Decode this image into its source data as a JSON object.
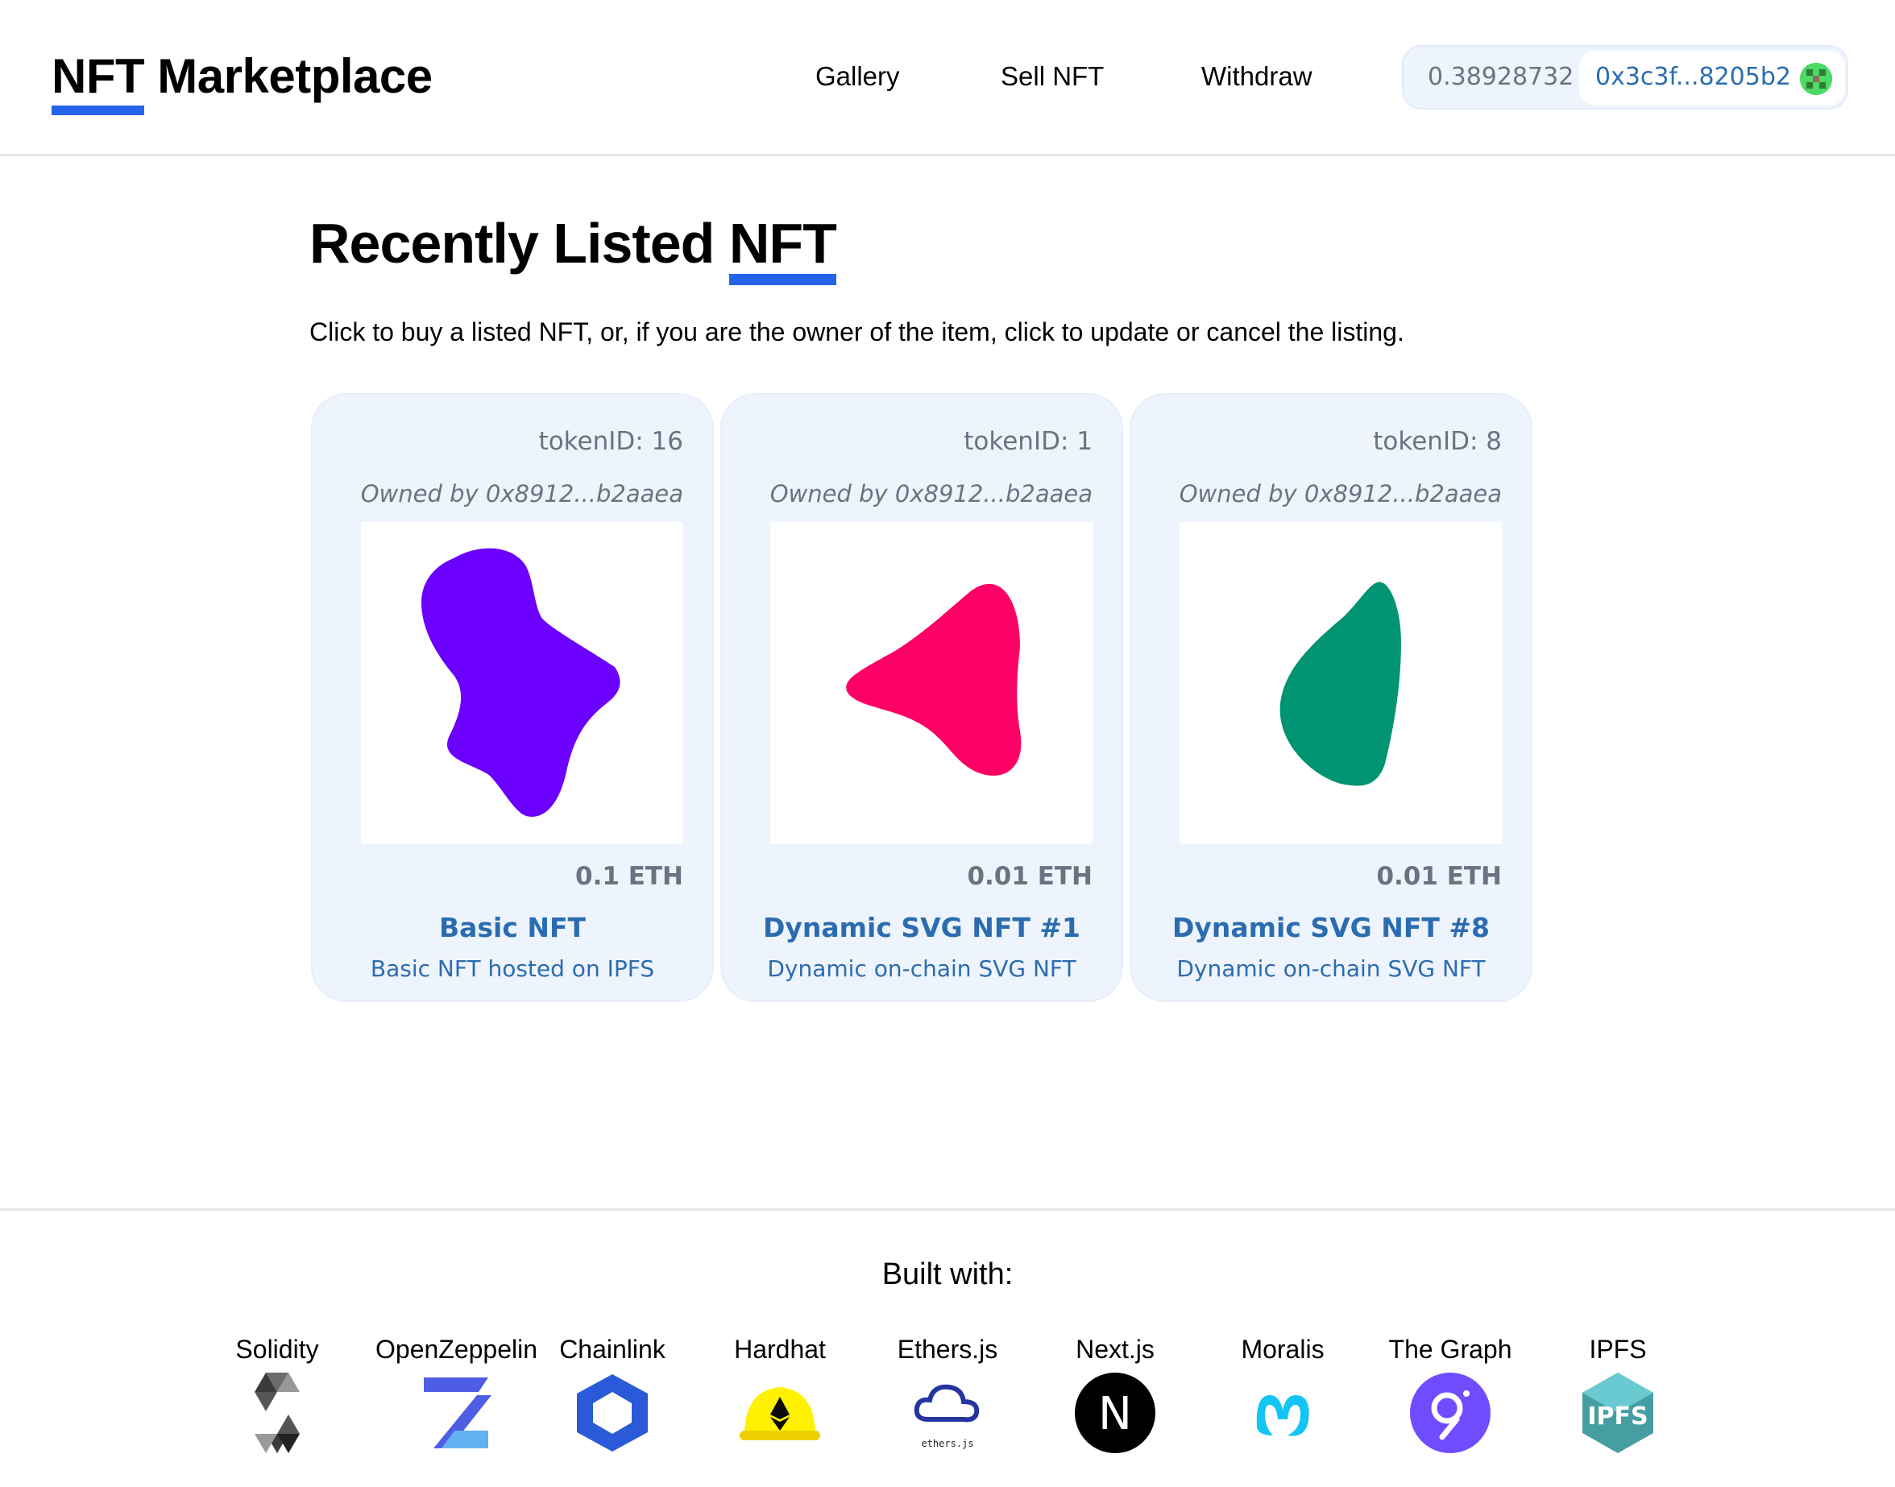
{
  "header": {
    "brand_part1": "NFT",
    "brand_part2": " Marketplace",
    "nav": {
      "gallery": "Gallery",
      "sell": "Sell NFT",
      "withdraw": "Withdraw"
    },
    "wallet": {
      "balance": "0.38928732",
      "address": "0x3c3f...8205b2"
    }
  },
  "main": {
    "title_part1": "Recently Listed ",
    "title_part2": "NFT",
    "subtitle": "Click to buy a listed NFT, or, if you are the owner of the item, click to update or cancel the listing.",
    "cards": [
      {
        "token": "tokenID: 16",
        "owner": "Owned by 0x8912...b2aaea",
        "price": "0.1 ETH",
        "name": "Basic NFT",
        "description": "Basic NFT hosted on IPFS",
        "color": "#6b00ff"
      },
      {
        "token": "tokenID: 1",
        "owner": "Owned by 0x8912...b2aaea",
        "price": "0.01 ETH",
        "name": "Dynamic SVG NFT #1",
        "description": "Dynamic on-chain SVG NFT",
        "color": "#ff0066"
      },
      {
        "token": "tokenID: 8",
        "owner": "Owned by 0x8912...b2aaea",
        "price": "0.01 ETH",
        "name": "Dynamic SVG NFT #8",
        "description": "Dynamic on-chain SVG NFT",
        "color": "#009473"
      }
    ]
  },
  "footer": {
    "built_with": "Built with:",
    "tech": [
      {
        "name": "Solidity",
        "icon": "solidity-icon"
      },
      {
        "name": "OpenZeppelin",
        "icon": "openzeppelin-icon"
      },
      {
        "name": "Chainlink",
        "icon": "chainlink-icon"
      },
      {
        "name": "Hardhat",
        "icon": "hardhat-icon"
      },
      {
        "name": "Ethers.js",
        "icon": "ethersjs-icon",
        "icon_text": "ethers.js"
      },
      {
        "name": "Next.js",
        "icon": "nextjs-icon",
        "icon_text": "N"
      },
      {
        "name": "Moralis",
        "icon": "moralis-icon"
      },
      {
        "name": "The Graph",
        "icon": "thegraph-icon"
      },
      {
        "name": "IPFS",
        "icon": "ipfs-icon",
        "icon_text": "IPFS"
      }
    ]
  },
  "colors": {
    "accent": "#2563eb",
    "link": "#2b6cb0",
    "card_bg": "#eef4fd",
    "muted": "#6b7280"
  }
}
